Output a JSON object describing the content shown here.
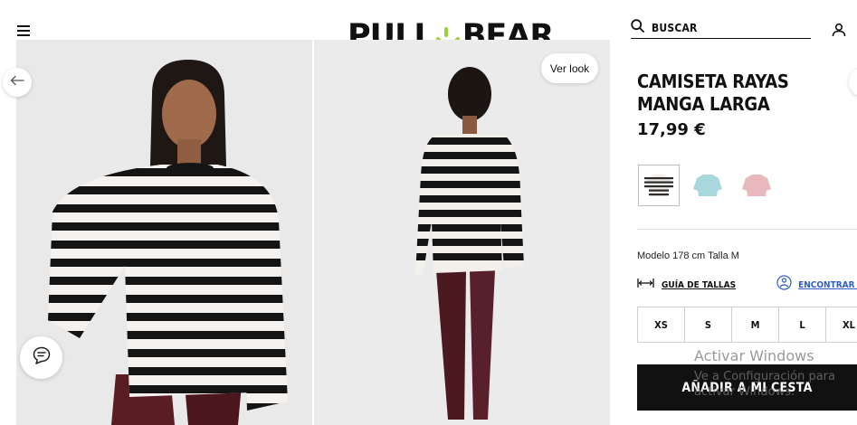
{
  "header": {
    "brand_left": "PULL",
    "brand_right": "BEAR",
    "search_label": "BUSCAR",
    "brand_accent": "#9bd13a"
  },
  "gallery": {
    "view_look_label": "Ver look"
  },
  "product": {
    "title_line1": "CAMISETA RAYAS",
    "title_line2": "MANGA LARGA",
    "price": "17,99 €",
    "colors": [
      {
        "name": "black-white stripes",
        "swatch": "#2b2b2b",
        "selected": true
      },
      {
        "name": "light blue",
        "swatch": "#a9d8dc",
        "selected": false
      },
      {
        "name": "pink",
        "swatch": "#e8b8bd",
        "selected": false
      }
    ],
    "model_info": "Modelo 178 cm Talla M",
    "size_guide_label": "GUÍA DE TALLAS",
    "find_in_store_label": "ENCONTRAR MI T",
    "sizes": [
      "XS",
      "S",
      "M",
      "L",
      "XL"
    ],
    "add_to_cart_label": "AÑADIR A MI CESTA"
  },
  "os_overlay": {
    "line1": "Activar Windows",
    "line2": "Ve a Configuración para activar Windows."
  }
}
